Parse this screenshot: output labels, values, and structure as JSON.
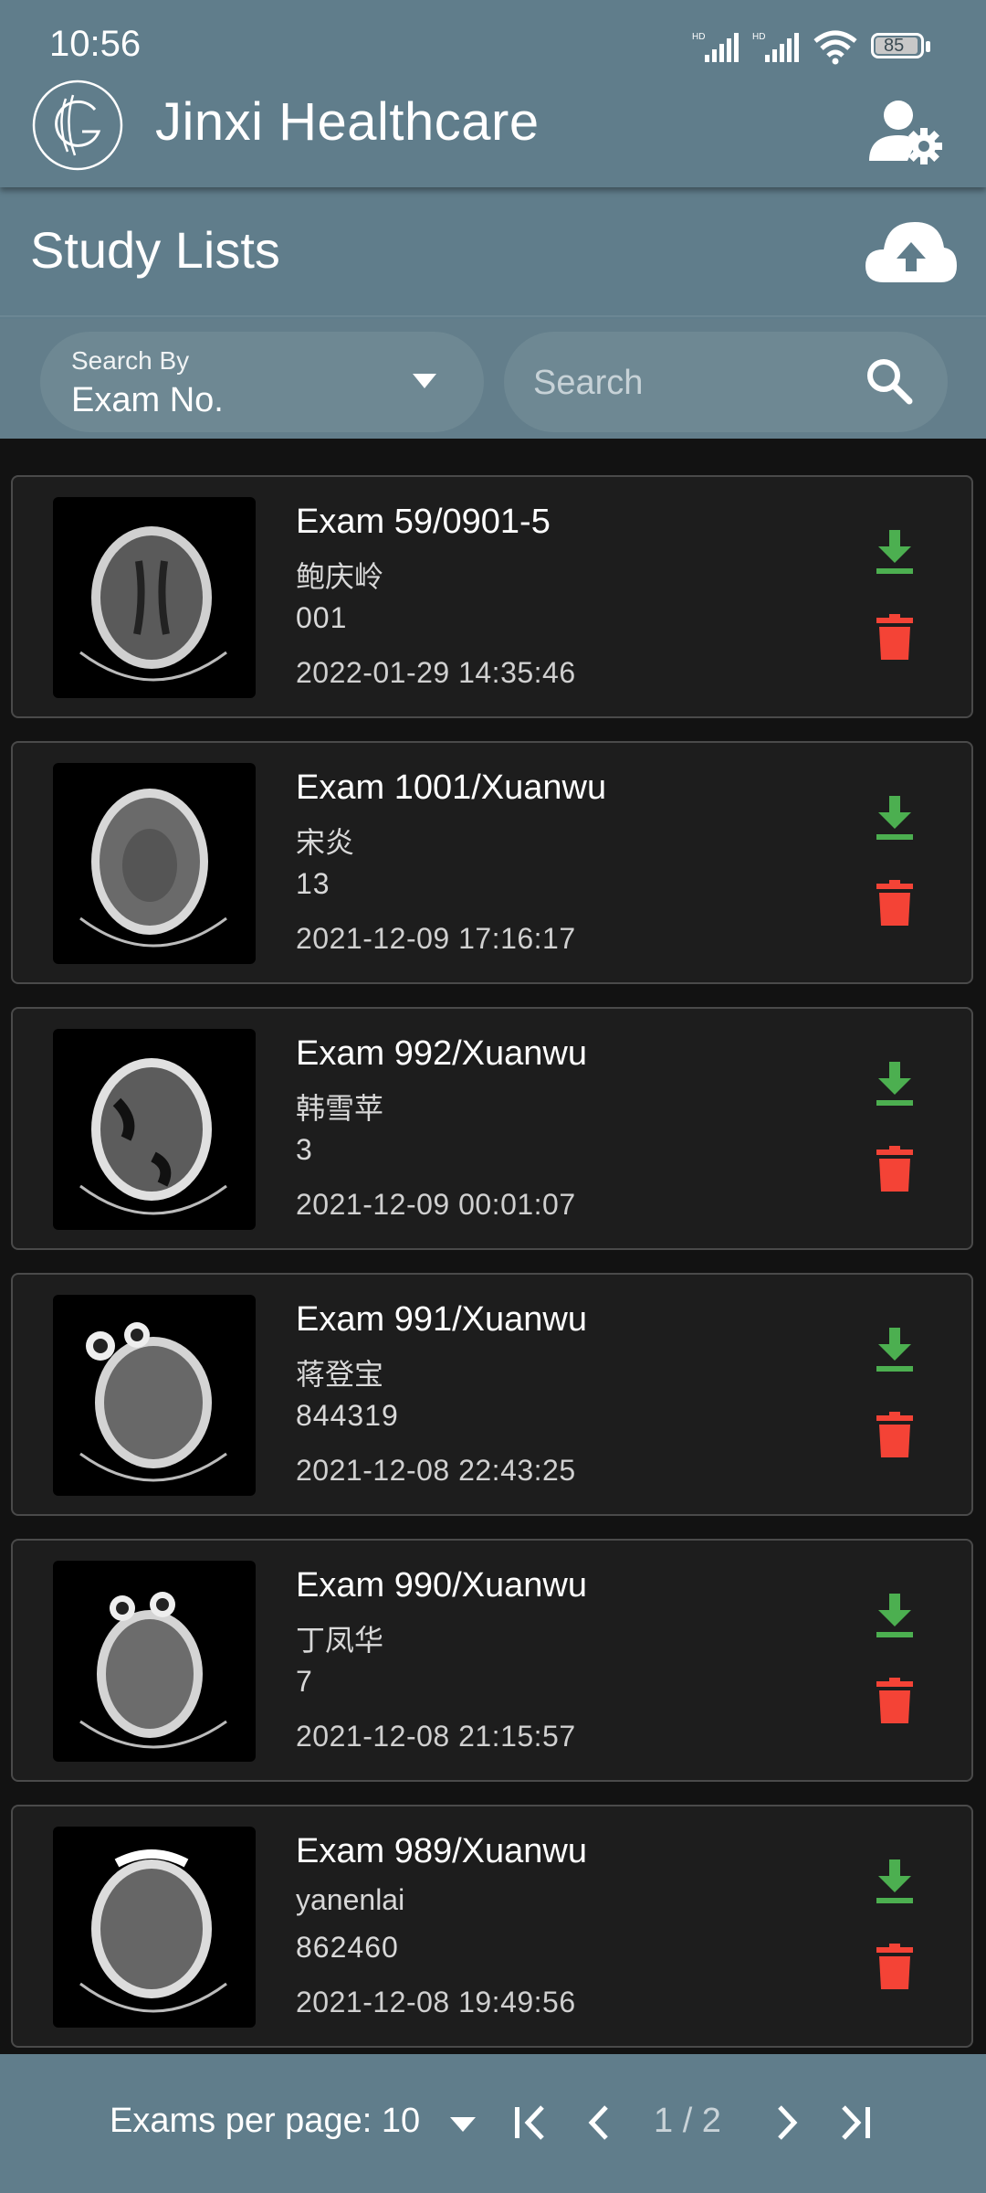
{
  "status_bar": {
    "time": "10:56",
    "battery": "85"
  },
  "app": {
    "title": "Jinxi Healthcare"
  },
  "header": {
    "title": "Study Lists"
  },
  "filter": {
    "search_by_label": "Search By",
    "search_by_value": "Exam No.",
    "search_placeholder": "Search"
  },
  "studies": [
    {
      "title": "Exam 59/0901-5",
      "name": "鲍庆岭",
      "id": "001",
      "date": "2022-01-29 14:35:46"
    },
    {
      "title": "Exam 1001/Xuanwu",
      "name": "宋炎",
      "id": "13",
      "date": "2021-12-09 17:16:17"
    },
    {
      "title": "Exam 992/Xuanwu",
      "name": "韩雪苹",
      "id": "3",
      "date": "2021-12-09 00:01:07"
    },
    {
      "title": "Exam 991/Xuanwu",
      "name": "蒋登宝",
      "id": "844319",
      "date": "2021-12-08 22:43:25"
    },
    {
      "title": "Exam 990/Xuanwu",
      "name": "丁凤华",
      "id": "7",
      "date": "2021-12-08 21:15:57"
    },
    {
      "title": "Exam 989/Xuanwu",
      "name": "yanenlai",
      "id": "862460",
      "date": "2021-12-08 19:49:56"
    }
  ],
  "pagination": {
    "per_page_label": "Exams per page: 10",
    "page_indicator": "1 / 2"
  },
  "colors": {
    "primary": "#607d8b",
    "download": "#4caf50",
    "delete": "#f44336",
    "card": "#1d1d1d"
  },
  "icons": [
    "logo-icon",
    "user-settings-icon",
    "cloud-upload-icon",
    "dropdown-caret-icon",
    "search-icon",
    "download-icon",
    "delete-icon",
    "first-page-icon",
    "prev-page-icon",
    "next-page-icon",
    "last-page-icon"
  ]
}
